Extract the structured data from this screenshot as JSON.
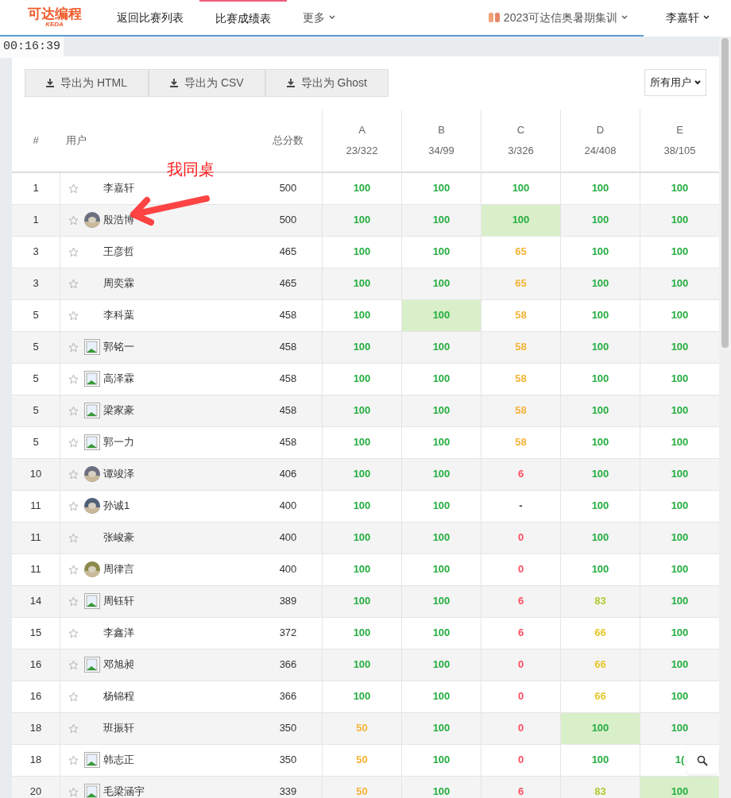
{
  "nav": {
    "logo": "可达编程",
    "logo_sub": "KEDA",
    "links": [
      {
        "label": "返回比赛列表",
        "selected": false
      },
      {
        "label": "比赛成绩表",
        "selected": true
      },
      {
        "label": "更多",
        "selected": false,
        "dropdown": true
      }
    ],
    "domain": "2023可达信奥暑期集训",
    "user": "李嘉轩"
  },
  "timer": "00:16:39",
  "export_buttons": [
    "导出为 HTML",
    "导出为 CSV",
    "导出为 Ghost"
  ],
  "filter": "所有用户",
  "table": {
    "columns": [
      {
        "title": "#"
      },
      {
        "title": "用户"
      },
      {
        "title": "总分数"
      },
      {
        "title": "A",
        "sub": "23/322"
      },
      {
        "title": "B",
        "sub": "34/99"
      },
      {
        "title": "C",
        "sub": "3/326"
      },
      {
        "title": "D",
        "sub": "24/408"
      },
      {
        "title": "E",
        "sub": "38/105"
      }
    ],
    "rows": [
      {
        "rank": "1",
        "name": "李嘉轩",
        "total": "500",
        "scores": [
          {
            "v": "100",
            "color": "#25ad40",
            "first": false
          },
          {
            "v": "100",
            "color": "#25ad40",
            "first": false
          },
          {
            "v": "100",
            "color": "#25ad40",
            "first": false
          },
          {
            "v": "100",
            "color": "#25ad40",
            "first": false
          },
          {
            "v": "100",
            "color": "#25ad40",
            "first": false
          }
        ]
      },
      {
        "rank": "1",
        "name": "殷浩博",
        "total": "500",
        "scores": [
          {
            "v": "100",
            "color": "#25ad40",
            "first": false
          },
          {
            "v": "100",
            "color": "#25ad40",
            "first": false
          },
          {
            "v": "100",
            "color": "#25ad40",
            "first": true
          },
          {
            "v": "100",
            "color": "#25ad40",
            "first": false
          },
          {
            "v": "100",
            "color": "#25ad40",
            "first": false
          }
        ]
      },
      {
        "rank": "3",
        "name": "王彦哲",
        "total": "465",
        "scores": [
          {
            "v": "100",
            "color": "#25ad40",
            "first": false
          },
          {
            "v": "100",
            "color": "#25ad40",
            "first": false
          },
          {
            "v": "65",
            "color": "#f5b335",
            "first": false
          },
          {
            "v": "100",
            "color": "#25ad40",
            "first": false
          },
          {
            "v": "100",
            "color": "#25ad40",
            "first": false
          }
        ]
      },
      {
        "rank": "3",
        "name": "周奕霖",
        "total": "465",
        "scores": [
          {
            "v": "100",
            "color": "#25ad40",
            "first": false
          },
          {
            "v": "100",
            "color": "#25ad40",
            "first": false
          },
          {
            "v": "65",
            "color": "#f5b335",
            "first": false
          },
          {
            "v": "100",
            "color": "#25ad40",
            "first": false
          },
          {
            "v": "100",
            "color": "#25ad40",
            "first": false
          }
        ]
      },
      {
        "rank": "5",
        "name": "李科葉",
        "total": "458",
        "scores": [
          {
            "v": "100",
            "color": "#25ad40",
            "first": false
          },
          {
            "v": "100",
            "color": "#25ad40",
            "first": true
          },
          {
            "v": "58",
            "color": "#f5b335",
            "first": false
          },
          {
            "v": "100",
            "color": "#25ad40",
            "first": false
          },
          {
            "v": "100",
            "color": "#25ad40",
            "first": false
          }
        ]
      },
      {
        "rank": "5",
        "avatar": {
          "kind": "broken"
        },
        "name": "郭铭一",
        "total": "458",
        "scores": [
          {
            "v": "100",
            "color": "#25ad40",
            "first": false
          },
          {
            "v": "100",
            "color": "#25ad40",
            "first": false
          },
          {
            "v": "58",
            "color": "#f5b335",
            "first": false
          },
          {
            "v": "100",
            "color": "#25ad40",
            "first": false
          },
          {
            "v": "100",
            "color": "#25ad40",
            "first": false
          }
        ]
      },
      {
        "rank": "5",
        "avatar": {
          "kind": "broken"
        },
        "name": "高泽霖",
        "total": "458",
        "scores": [
          {
            "v": "100",
            "color": "#25ad40",
            "first": false
          },
          {
            "v": "100",
            "color": "#25ad40",
            "first": false
          },
          {
            "v": "58",
            "color": "#f5b335",
            "first": false
          },
          {
            "v": "100",
            "color": "#25ad40",
            "first": false
          },
          {
            "v": "100",
            "color": "#25ad40",
            "first": false
          }
        ]
      },
      {
        "rank": "5",
        "avatar": {
          "kind": "broken"
        },
        "name": "梁家豪",
        "total": "458",
        "scores": [
          {
            "v": "100",
            "color": "#25ad40",
            "first": false
          },
          {
            "v": "100",
            "color": "#25ad40",
            "first": false
          },
          {
            "v": "58",
            "color": "#f5b335",
            "first": false
          },
          {
            "v": "100",
            "color": "#25ad40",
            "first": false
          },
          {
            "v": "100",
            "color": "#25ad40",
            "first": false
          }
        ]
      },
      {
        "rank": "5",
        "avatar": {
          "kind": "broken"
        },
        "name": "郭一力",
        "total": "458",
        "scores": [
          {
            "v": "100",
            "color": "#25ad40",
            "first": false
          },
          {
            "v": "100",
            "color": "#25ad40",
            "first": false
          },
          {
            "v": "58",
            "color": "#f5b335",
            "first": false
          },
          {
            "v": "100",
            "color": "#25ad40",
            "first": false
          },
          {
            "v": "100",
            "color": "#25ad40",
            "first": false
          }
        ]
      },
      {
        "rank": "10",
        "name": "谭竣泽",
        "total": "406",
        "scores": [
          {
            "v": "100",
            "color": "#25ad40",
            "first": false
          },
          {
            "v": "100",
            "color": "#25ad40",
            "first": false
          },
          {
            "v": "6",
            "color": "#fe4c61",
            "first": false
          },
          {
            "v": "100",
            "color": "#25ad40",
            "first": false
          },
          {
            "v": "100",
            "color": "#25ad40",
            "first": false
          }
        ]
      },
      {
        "rank": "11",
        "name": "孙诚1",
        "total": "400",
        "scores": [
          {
            "v": "100",
            "color": "#25ad40",
            "first": false
          },
          {
            "v": "100",
            "color": "#25ad40",
            "first": false
          },
          {
            "v": "-",
            "color": "#333333",
            "first": false
          },
          {
            "v": "100",
            "color": "#25ad40",
            "first": false
          },
          {
            "v": "100",
            "color": "#25ad40",
            "first": false
          }
        ]
      },
      {
        "rank": "11",
        "name": "张峻豪",
        "total": "400",
        "scores": [
          {
            "v": "100",
            "color": "#25ad40",
            "first": false
          },
          {
            "v": "100",
            "color": "#25ad40",
            "first": false
          },
          {
            "v": "0",
            "color": "#fe4c61",
            "first": false
          },
          {
            "v": "100",
            "color": "#25ad40",
            "first": false
          },
          {
            "v": "100",
            "color": "#25ad40",
            "first": false
          }
        ]
      },
      {
        "rank": "11",
        "name": "周律言",
        "total": "400",
        "scores": [
          {
            "v": "100",
            "color": "#25ad40",
            "first": false
          },
          {
            "v": "100",
            "color": "#25ad40",
            "first": false
          },
          {
            "v": "0",
            "color": "#fe4c61",
            "first": false
          },
          {
            "v": "100",
            "color": "#25ad40",
            "first": false
          },
          {
            "v": "100",
            "color": "#25ad40",
            "first": false
          }
        ]
      },
      {
        "rank": "14",
        "avatar": {
          "kind": "broken"
        },
        "name": "周钰轩",
        "total": "389",
        "scores": [
          {
            "v": "100",
            "color": "#25ad40",
            "first": false
          },
          {
            "v": "100",
            "color": "#25ad40",
            "first": false
          },
          {
            "v": "6",
            "color": "#fe4c61",
            "first": false
          },
          {
            "v": "83",
            "color": "#b4c82f",
            "first": false
          },
          {
            "v": "100",
            "color": "#25ad40",
            "first": false
          }
        ]
      },
      {
        "rank": "15",
        "name": "李鑫洋",
        "total": "372",
        "scores": [
          {
            "v": "100",
            "color": "#25ad40",
            "first": false
          },
          {
            "v": "100",
            "color": "#25ad40",
            "first": false
          },
          {
            "v": "6",
            "color": "#fe4c61",
            "first": false
          },
          {
            "v": "66",
            "color": "#e6c72a",
            "first": false
          },
          {
            "v": "100",
            "color": "#25ad40",
            "first": false
          }
        ]
      },
      {
        "rank": "16",
        "avatar": {
          "kind": "broken"
        },
        "name": "邓旭昶",
        "total": "366",
        "scores": [
          {
            "v": "100",
            "color": "#25ad40",
            "first": false
          },
          {
            "v": "100",
            "color": "#25ad40",
            "first": false
          },
          {
            "v": "0",
            "color": "#fe4c61",
            "first": false
          },
          {
            "v": "66",
            "color": "#e6c72a",
            "first": false
          },
          {
            "v": "100",
            "color": "#25ad40",
            "first": false
          }
        ]
      },
      {
        "rank": "16",
        "name": "杨锦程",
        "total": "366",
        "scores": [
          {
            "v": "100",
            "color": "#25ad40",
            "first": false
          },
          {
            "v": "100",
            "color": "#25ad40",
            "first": false
          },
          {
            "v": "0",
            "color": "#fe4c61",
            "first": false
          },
          {
            "v": "66",
            "color": "#e6c72a",
            "first": false
          },
          {
            "v": "100",
            "color": "#25ad40",
            "first": false
          }
        ]
      },
      {
        "rank": "18",
        "name": "班振轩",
        "total": "350",
        "scores": [
          {
            "v": "50",
            "color": "#f5b335",
            "first": false
          },
          {
            "v": "100",
            "color": "#25ad40",
            "first": false
          },
          {
            "v": "0",
            "color": "#fe4c61",
            "first": false
          },
          {
            "v": "100",
            "color": "#25ad40",
            "first": true
          },
          {
            "v": "100",
            "color": "#25ad40",
            "first": false
          }
        ]
      },
      {
        "rank": "18",
        "avatar": {
          "kind": "broken"
        },
        "name": "韩志正",
        "total": "350",
        "scores": [
          {
            "v": "50",
            "color": "#f5b335",
            "first": false
          },
          {
            "v": "100",
            "color": "#25ad40",
            "first": false
          },
          {
            "v": "0",
            "color": "#fe4c61",
            "first": false
          },
          {
            "v": "100",
            "color": "#25ad40",
            "first": false
          },
          {
            "v": "1(",
            "color": "#25ad40",
            "first": false
          }
        ]
      },
      {
        "rank": "20",
        "avatar": {
          "kind": "broken"
        },
        "name": "毛梁涵宇",
        "total": "339",
        "scores": [
          {
            "v": "50",
            "color": "#f5b335",
            "first": false
          },
          {
            "v": "100",
            "color": "#25ad40",
            "first": false
          },
          {
            "v": "6",
            "color": "#fe4c61",
            "first": false
          },
          {
            "v": "83",
            "color": "#b4c82f",
            "first": false
          },
          {
            "v": "100",
            "color": "#25ad40",
            "first": true
          }
        ]
      }
    ]
  },
  "annotation": {
    "text": "我同桌"
  }
}
